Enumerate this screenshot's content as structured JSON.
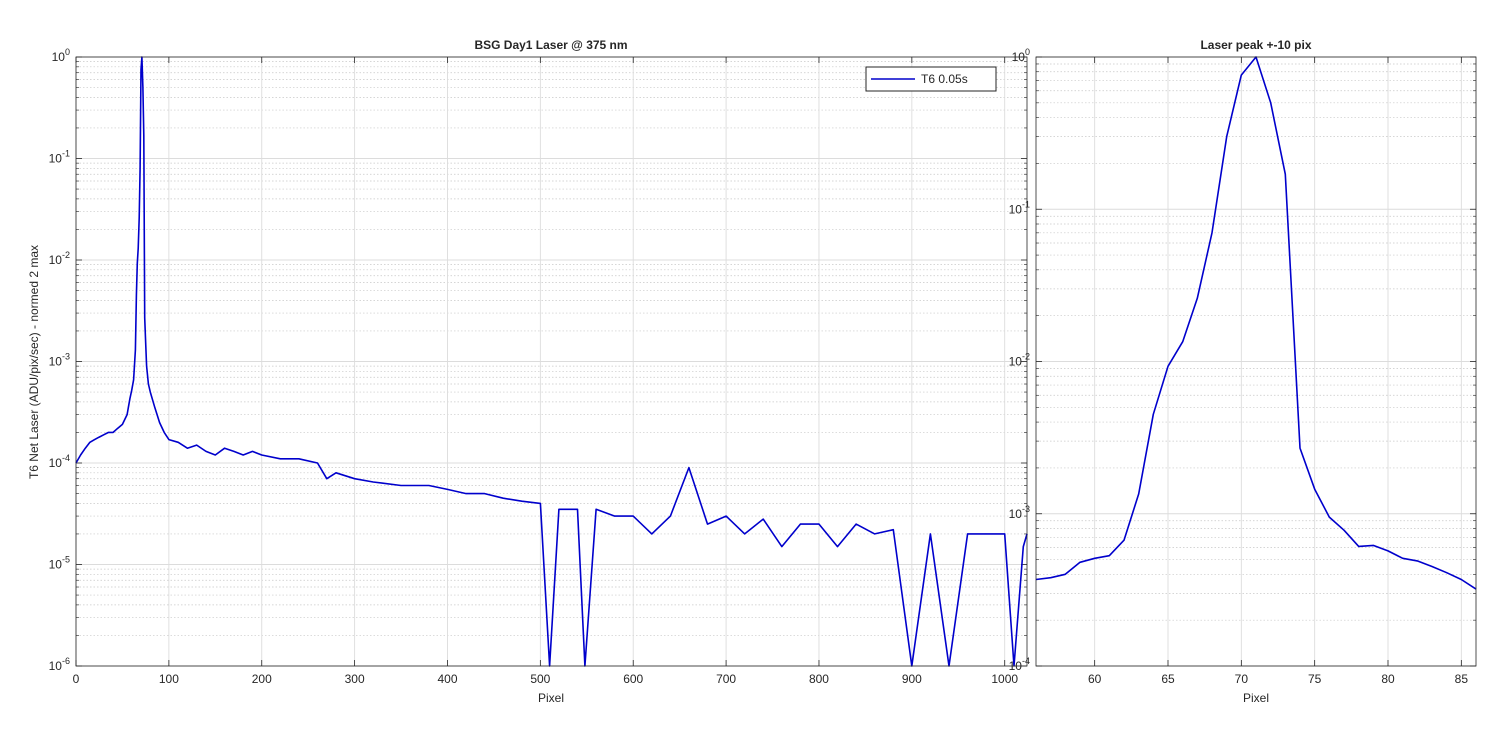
{
  "chart_data": [
    {
      "type": "line",
      "title": "BSG  Day1 Laser @ 375 nm",
      "xlabel": "Pixel",
      "ylabel": "T6 Net Laser (ADU/pix/sec) - normed 2 max",
      "xlim": [
        0,
        1024
      ],
      "ylim": [
        1e-06,
        1
      ],
      "yscale": "log",
      "x_ticks": [
        0,
        100,
        200,
        300,
        400,
        500,
        600,
        700,
        800,
        900,
        1000
      ],
      "y_ticks": [
        {
          "exp": "-6",
          "value": 1e-06
        },
        {
          "exp": "-5",
          "value": 1e-05
        },
        {
          "exp": "-4",
          "value": 0.0001
        },
        {
          "exp": "-3",
          "value": 0.001
        },
        {
          "exp": "-2",
          "value": 0.01
        },
        {
          "exp": "-1",
          "value": 0.1
        },
        {
          "exp": "0",
          "value": 1
        }
      ],
      "tick_base": "10",
      "grid": true,
      "legend": "top-right",
      "series": [
        {
          "name": "T6 0.05s",
          "color": "#0000cc",
          "x": [
            0,
            5,
            10,
            15,
            20,
            25,
            30,
            35,
            40,
            45,
            50,
            55,
            58,
            60,
            62,
            64,
            65,
            66,
            67,
            68,
            69,
            70,
            71,
            72,
            73,
            74,
            75,
            76,
            78,
            80,
            85,
            90,
            95,
            100,
            110,
            120,
            130,
            140,
            150,
            160,
            170,
            180,
            190,
            200,
            220,
            240,
            260,
            270,
            280,
            300,
            320,
            350,
            380,
            400,
            420,
            440,
            460,
            480,
            500,
            510,
            520,
            540,
            548,
            560,
            580,
            600,
            620,
            640,
            660,
            680,
            700,
            720,
            740,
            760,
            780,
            800,
            820,
            840,
            860,
            880,
            900,
            920,
            940,
            960,
            980,
            1000,
            1010,
            1020,
            1024
          ],
          "y": [
            0.0001,
            0.00012,
            0.00014,
            0.00016,
            0.00017,
            0.00018,
            0.00019,
            0.0002,
            0.0002,
            0.00022,
            0.00024,
            0.0003,
            0.00043,
            0.00052,
            0.00066,
            0.0013,
            0.0045,
            0.0093,
            0.013,
            0.026,
            0.08,
            0.75,
            1.0,
            0.5,
            0.17,
            0.0027,
            0.0015,
            0.0009,
            0.0006,
            0.0005,
            0.00035,
            0.00025,
            0.0002,
            0.00017,
            0.00016,
            0.00014,
            0.00015,
            0.00013,
            0.00012,
            0.00014,
            0.00013,
            0.00012,
            0.00013,
            0.00012,
            0.00011,
            0.00011,
            0.0001,
            7e-05,
            8e-05,
            7e-05,
            6.5e-05,
            6e-05,
            6e-05,
            5.5e-05,
            5e-05,
            5e-05,
            4.5e-05,
            4.2e-05,
            4e-05,
            1e-06,
            3.5e-05,
            3.5e-05,
            1e-06,
            3.5e-05,
            3e-05,
            3e-05,
            2e-05,
            3e-05,
            9e-05,
            2.5e-05,
            3e-05,
            2e-05,
            2.8e-05,
            1.5e-05,
            2.5e-05,
            2.5e-05,
            1.5e-05,
            2.5e-05,
            2e-05,
            2.2e-05,
            1e-06,
            2e-05,
            1e-06,
            2e-05,
            2e-05,
            2e-05,
            1e-06,
            1.5e-05,
            2e-05
          ]
        }
      ]
    },
    {
      "type": "line",
      "title": "Laser peak +-10 pix",
      "xlabel": "Pixel",
      "ylabel": "",
      "xlim": [
        56,
        86
      ],
      "ylim": [
        0.0001,
        1
      ],
      "yscale": "log",
      "x_ticks": [
        60,
        65,
        70,
        75,
        80,
        85
      ],
      "y_ticks": [
        {
          "exp": "-4",
          "value": 0.0001
        },
        {
          "exp": "-3",
          "value": 0.001
        },
        {
          "exp": "-2",
          "value": 0.01
        },
        {
          "exp": "-1",
          "value": 0.1
        },
        {
          "exp": "0",
          "value": 1
        }
      ],
      "tick_base": "10",
      "grid": true,
      "series": [
        {
          "color": "#0000cc",
          "x": [
            56,
            57,
            58,
            59,
            60,
            61,
            62,
            63,
            64,
            65,
            66,
            67,
            68,
            69,
            70,
            71,
            72,
            73,
            74,
            75,
            76,
            77,
            78,
            79,
            80,
            81,
            82,
            83,
            84,
            85,
            86
          ],
          "y": [
            0.00037,
            0.00038,
            0.0004,
            0.00048,
            0.00051,
            0.00053,
            0.00067,
            0.00135,
            0.0045,
            0.0093,
            0.0135,
            0.026,
            0.07,
            0.3,
            0.76,
            1.0,
            0.5,
            0.17,
            0.0027,
            0.00145,
            0.00095,
            0.00078,
            0.00061,
            0.00062,
            0.00057,
            0.00051,
            0.00049,
            0.00045,
            0.00041,
            0.00037,
            0.00032
          ]
        }
      ]
    }
  ]
}
